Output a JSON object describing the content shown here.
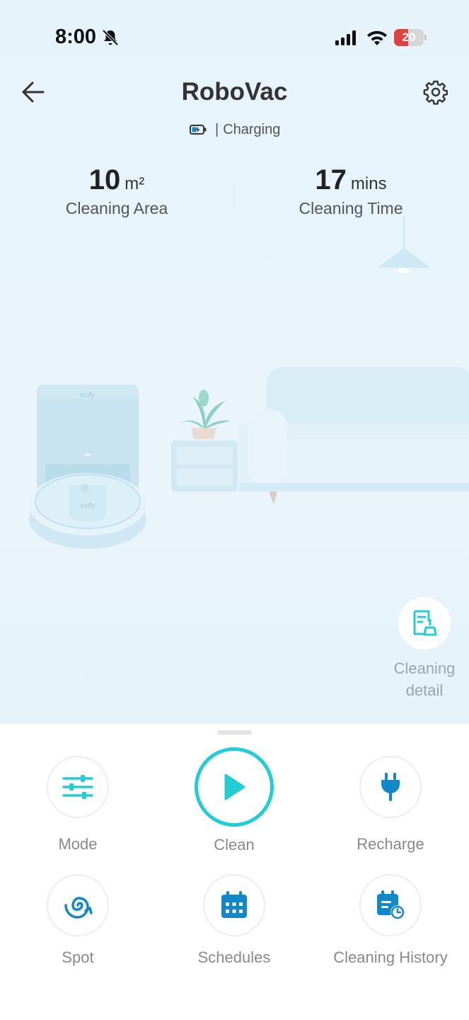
{
  "status_bar": {
    "time": "8:00",
    "battery_level": "20"
  },
  "header": {
    "title": "RoboVac",
    "status_separator": "|",
    "status_text": "Charging"
  },
  "stats": {
    "area": {
      "value": "10",
      "unit": "m²",
      "label": "Cleaning Area"
    },
    "time": {
      "value": "17",
      "unit": "mins",
      "label": "Cleaning Time"
    }
  },
  "illustration": {
    "brand_text": "eufy"
  },
  "detail": {
    "label": "Cleaning detail"
  },
  "controls": {
    "mode": "Mode",
    "clean": "Clean",
    "recharge": "Recharge",
    "spot": "Spot",
    "schedules": "Schedules",
    "history": "Cleaning History"
  },
  "colors": {
    "accent": "#22cdd6",
    "icon_blue": "#1287c9",
    "battery_low": "#e24040"
  }
}
